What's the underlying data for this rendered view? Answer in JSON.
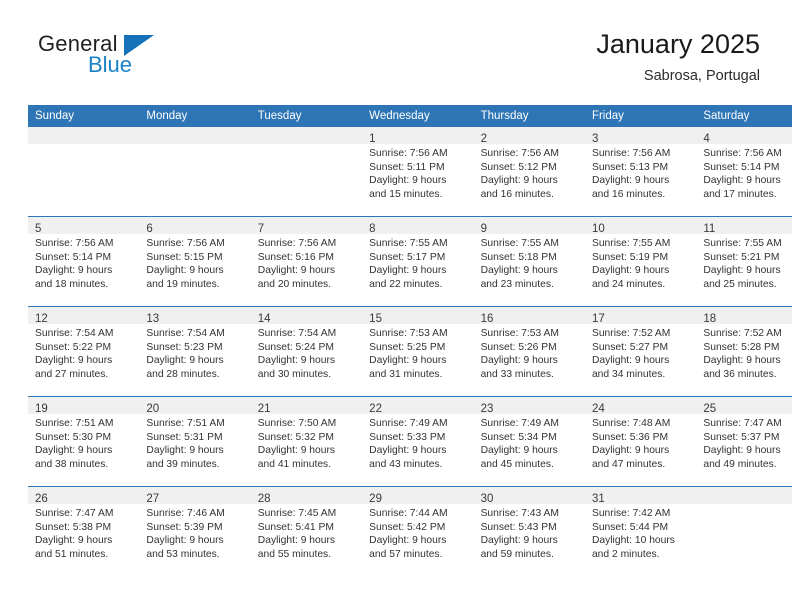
{
  "brand": {
    "name_part1": "General",
    "name_part2": "Blue",
    "triangle_icon": "triangle-icon",
    "accent_color": "#1b82c8"
  },
  "header": {
    "title": "January 2025",
    "subtitle": "Sabrosa, Portugal"
  },
  "theme": {
    "header_bar_color": "#2e75b6",
    "daynum_band_color": "#f0f0f0",
    "row_border_color": "#2e75b6",
    "text_color": "#333333"
  },
  "weekday_headers": [
    "Sunday",
    "Monday",
    "Tuesday",
    "Wednesday",
    "Thursday",
    "Friday",
    "Saturday"
  ],
  "weeks": [
    [
      {
        "day": "",
        "lines": []
      },
      {
        "day": "",
        "lines": []
      },
      {
        "day": "",
        "lines": []
      },
      {
        "day": "1",
        "lines": [
          "Sunrise: 7:56 AM",
          "Sunset: 5:11 PM",
          "Daylight: 9 hours",
          "and 15 minutes."
        ]
      },
      {
        "day": "2",
        "lines": [
          "Sunrise: 7:56 AM",
          "Sunset: 5:12 PM",
          "Daylight: 9 hours",
          "and 16 minutes."
        ]
      },
      {
        "day": "3",
        "lines": [
          "Sunrise: 7:56 AM",
          "Sunset: 5:13 PM",
          "Daylight: 9 hours",
          "and 16 minutes."
        ]
      },
      {
        "day": "4",
        "lines": [
          "Sunrise: 7:56 AM",
          "Sunset: 5:14 PM",
          "Daylight: 9 hours",
          "and 17 minutes."
        ]
      }
    ],
    [
      {
        "day": "5",
        "lines": [
          "Sunrise: 7:56 AM",
          "Sunset: 5:14 PM",
          "Daylight: 9 hours",
          "and 18 minutes."
        ]
      },
      {
        "day": "6",
        "lines": [
          "Sunrise: 7:56 AM",
          "Sunset: 5:15 PM",
          "Daylight: 9 hours",
          "and 19 minutes."
        ]
      },
      {
        "day": "7",
        "lines": [
          "Sunrise: 7:56 AM",
          "Sunset: 5:16 PM",
          "Daylight: 9 hours",
          "and 20 minutes."
        ]
      },
      {
        "day": "8",
        "lines": [
          "Sunrise: 7:55 AM",
          "Sunset: 5:17 PM",
          "Daylight: 9 hours",
          "and 22 minutes."
        ]
      },
      {
        "day": "9",
        "lines": [
          "Sunrise: 7:55 AM",
          "Sunset: 5:18 PM",
          "Daylight: 9 hours",
          "and 23 minutes."
        ]
      },
      {
        "day": "10",
        "lines": [
          "Sunrise: 7:55 AM",
          "Sunset: 5:19 PM",
          "Daylight: 9 hours",
          "and 24 minutes."
        ]
      },
      {
        "day": "11",
        "lines": [
          "Sunrise: 7:55 AM",
          "Sunset: 5:21 PM",
          "Daylight: 9 hours",
          "and 25 minutes."
        ]
      }
    ],
    [
      {
        "day": "12",
        "lines": [
          "Sunrise: 7:54 AM",
          "Sunset: 5:22 PM",
          "Daylight: 9 hours",
          "and 27 minutes."
        ]
      },
      {
        "day": "13",
        "lines": [
          "Sunrise: 7:54 AM",
          "Sunset: 5:23 PM",
          "Daylight: 9 hours",
          "and 28 minutes."
        ]
      },
      {
        "day": "14",
        "lines": [
          "Sunrise: 7:54 AM",
          "Sunset: 5:24 PM",
          "Daylight: 9 hours",
          "and 30 minutes."
        ]
      },
      {
        "day": "15",
        "lines": [
          "Sunrise: 7:53 AM",
          "Sunset: 5:25 PM",
          "Daylight: 9 hours",
          "and 31 minutes."
        ]
      },
      {
        "day": "16",
        "lines": [
          "Sunrise: 7:53 AM",
          "Sunset: 5:26 PM",
          "Daylight: 9 hours",
          "and 33 minutes."
        ]
      },
      {
        "day": "17",
        "lines": [
          "Sunrise: 7:52 AM",
          "Sunset: 5:27 PM",
          "Daylight: 9 hours",
          "and 34 minutes."
        ]
      },
      {
        "day": "18",
        "lines": [
          "Sunrise: 7:52 AM",
          "Sunset: 5:28 PM",
          "Daylight: 9 hours",
          "and 36 minutes."
        ]
      }
    ],
    [
      {
        "day": "19",
        "lines": [
          "Sunrise: 7:51 AM",
          "Sunset: 5:30 PM",
          "Daylight: 9 hours",
          "and 38 minutes."
        ]
      },
      {
        "day": "20",
        "lines": [
          "Sunrise: 7:51 AM",
          "Sunset: 5:31 PM",
          "Daylight: 9 hours",
          "and 39 minutes."
        ]
      },
      {
        "day": "21",
        "lines": [
          "Sunrise: 7:50 AM",
          "Sunset: 5:32 PM",
          "Daylight: 9 hours",
          "and 41 minutes."
        ]
      },
      {
        "day": "22",
        "lines": [
          "Sunrise: 7:49 AM",
          "Sunset: 5:33 PM",
          "Daylight: 9 hours",
          "and 43 minutes."
        ]
      },
      {
        "day": "23",
        "lines": [
          "Sunrise: 7:49 AM",
          "Sunset: 5:34 PM",
          "Daylight: 9 hours",
          "and 45 minutes."
        ]
      },
      {
        "day": "24",
        "lines": [
          "Sunrise: 7:48 AM",
          "Sunset: 5:36 PM",
          "Daylight: 9 hours",
          "and 47 minutes."
        ]
      },
      {
        "day": "25",
        "lines": [
          "Sunrise: 7:47 AM",
          "Sunset: 5:37 PM",
          "Daylight: 9 hours",
          "and 49 minutes."
        ]
      }
    ],
    [
      {
        "day": "26",
        "lines": [
          "Sunrise: 7:47 AM",
          "Sunset: 5:38 PM",
          "Daylight: 9 hours",
          "and 51 minutes."
        ]
      },
      {
        "day": "27",
        "lines": [
          "Sunrise: 7:46 AM",
          "Sunset: 5:39 PM",
          "Daylight: 9 hours",
          "and 53 minutes."
        ]
      },
      {
        "day": "28",
        "lines": [
          "Sunrise: 7:45 AM",
          "Sunset: 5:41 PM",
          "Daylight: 9 hours",
          "and 55 minutes."
        ]
      },
      {
        "day": "29",
        "lines": [
          "Sunrise: 7:44 AM",
          "Sunset: 5:42 PM",
          "Daylight: 9 hours",
          "and 57 minutes."
        ]
      },
      {
        "day": "30",
        "lines": [
          "Sunrise: 7:43 AM",
          "Sunset: 5:43 PM",
          "Daylight: 9 hours",
          "and 59 minutes."
        ]
      },
      {
        "day": "31",
        "lines": [
          "Sunrise: 7:42 AM",
          "Sunset: 5:44 PM",
          "Daylight: 10 hours",
          "and 2 minutes."
        ]
      },
      {
        "day": "",
        "lines": []
      }
    ]
  ]
}
